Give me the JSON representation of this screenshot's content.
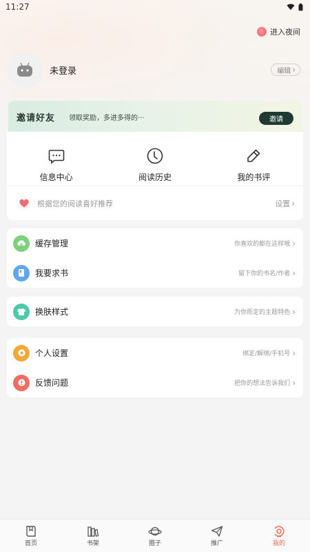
{
  "status_bar": {
    "time": "11:27"
  },
  "night_mode": {
    "label": "进入夜间"
  },
  "profile": {
    "name": "未登录",
    "edit_label": "编辑"
  },
  "banner": {
    "title": "邀请好友",
    "subtitle": "领取奖励，多进多得的···",
    "button": "邀请"
  },
  "quick_actions": [
    {
      "label": "信息中心",
      "icon": "message-icon"
    },
    {
      "label": "阅读历史",
      "icon": "clock-icon"
    },
    {
      "label": "我的书评",
      "icon": "pen-icon"
    }
  ],
  "recommend": {
    "label": "根据您的阅读喜好推荐",
    "action": "设置"
  },
  "group1": [
    {
      "label": "缓存管理",
      "hint": "你喜欢的都在这样哦",
      "icon": "cloud-download-icon",
      "color": "#7ed07a"
    },
    {
      "label": "我要求书",
      "hint": "留下你的书名/作者",
      "icon": "book-icon",
      "color": "#5fa6ea"
    }
  ],
  "group2": [
    {
      "label": "换肤样式",
      "hint": "为你而定的主题特色",
      "icon": "shirt-icon",
      "color": "#4ec9a5"
    }
  ],
  "group3": [
    {
      "label": "个人设置",
      "hint": "绑定/解绑/手机号",
      "icon": "settings-icon",
      "color": "#f3a93a"
    },
    {
      "label": "反馈问题",
      "hint": "把你的想法告诉我们",
      "icon": "feedback-icon",
      "color": "#ef6d63"
    }
  ],
  "tabbar": [
    {
      "label": "首页",
      "icon": "home-book-icon"
    },
    {
      "label": "书架",
      "icon": "bookshelf-icon"
    },
    {
      "label": "圈子",
      "icon": "planet-icon"
    },
    {
      "label": "推广",
      "icon": "paper-plane-icon"
    },
    {
      "label": "我的",
      "icon": "profile-icon",
      "active": true
    }
  ],
  "colors": {
    "accent": "#ee6b4d",
    "invite_button": "#1f3a32"
  }
}
